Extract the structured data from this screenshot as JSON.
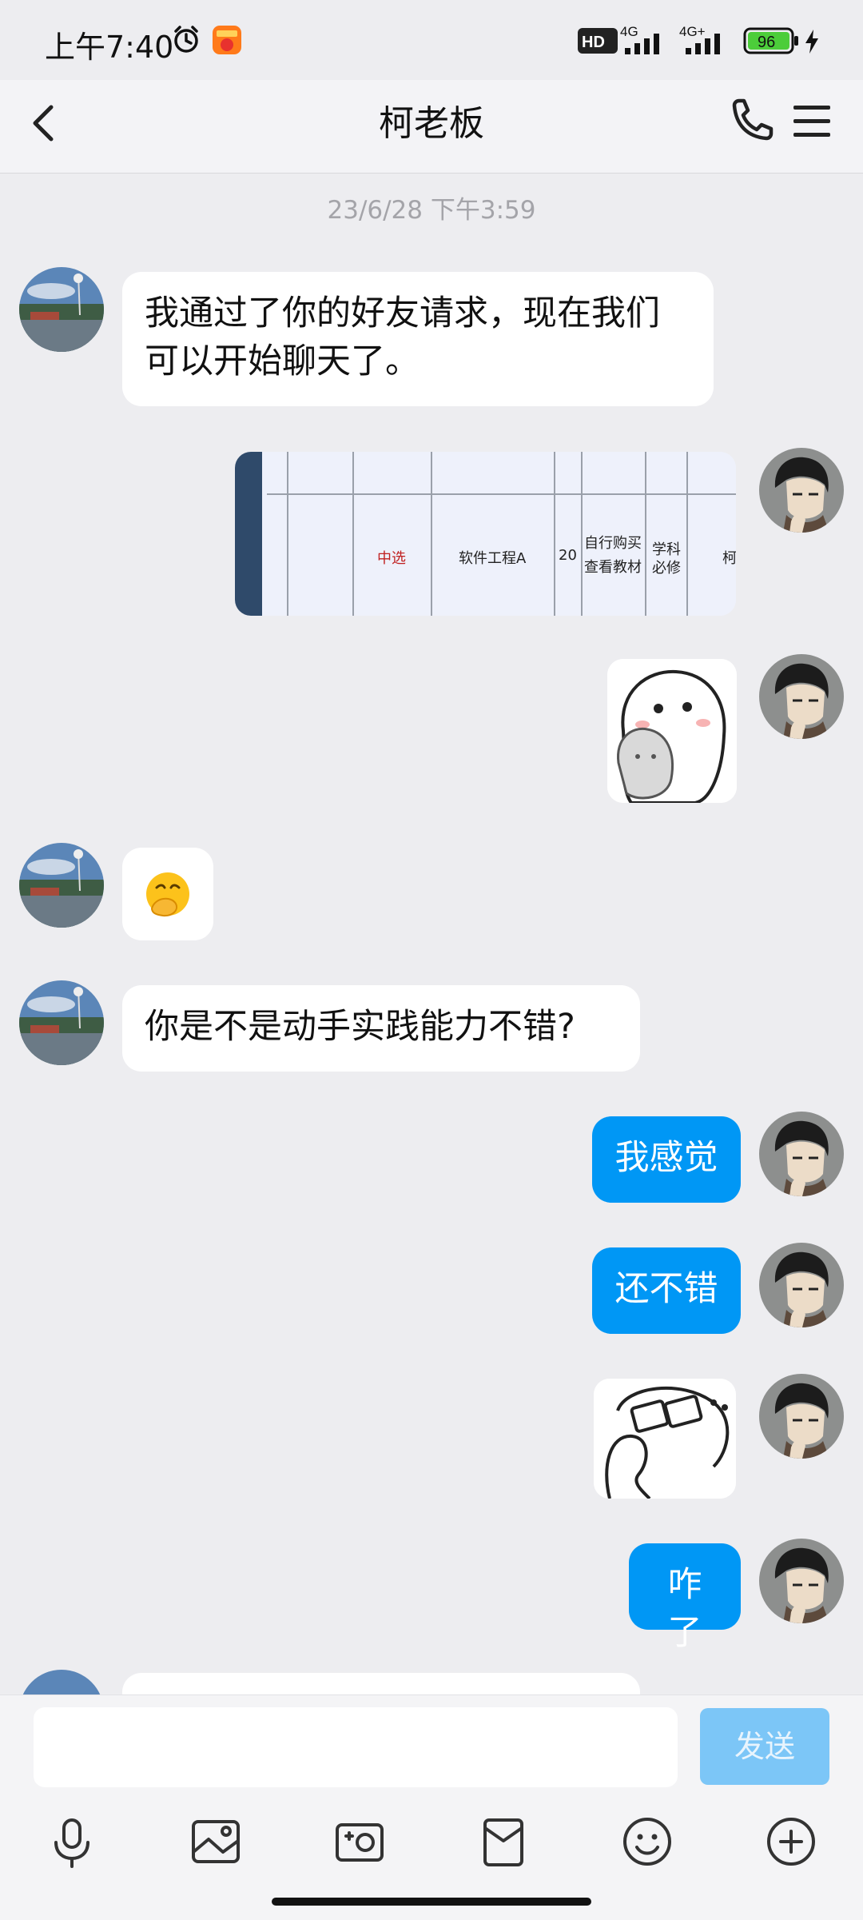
{
  "status": {
    "time": "上午7:40",
    "network_1": "4G",
    "network_2": "4G+",
    "battery": "96",
    "hd_label": "HD"
  },
  "header": {
    "title": "柯老板",
    "back_icon": "chevron-left-icon",
    "call_icon": "phone-icon",
    "menu_icon": "menu-icon"
  },
  "chat": {
    "timestamp": "23/6/28 下午3:59",
    "messages": [
      {
        "sender": "other",
        "type": "text",
        "text": "我通过了你的好友请求，现在我们可以开始聊天了。"
      },
      {
        "sender": "me",
        "type": "image",
        "cells": [
          "中选",
          "软件工程A",
          "20",
          "自行购买",
          "查看教材",
          "学科",
          "必修",
          "柯"
        ]
      },
      {
        "sender": "me",
        "type": "sticker"
      },
      {
        "sender": "other",
        "type": "emoji",
        "text": "🤭"
      },
      {
        "sender": "other",
        "type": "text",
        "text": "你是不是动手实践能力不错?"
      },
      {
        "sender": "me",
        "type": "text",
        "text": "我感觉"
      },
      {
        "sender": "me",
        "type": "text",
        "text": "还不错"
      },
      {
        "sender": "me",
        "type": "sticker"
      },
      {
        "sender": "me",
        "type": "text",
        "text": "咋了"
      }
    ]
  },
  "composer": {
    "input_value": "",
    "send_label": "发送",
    "tools": [
      "microphone-icon",
      "image-icon",
      "camera-icon",
      "red-packet-icon",
      "emoji-icon",
      "plus-icon"
    ]
  },
  "colors": {
    "my_bubble": "#0097f5",
    "send_disabled": "#7cc6f7",
    "background": "#ededf0"
  }
}
